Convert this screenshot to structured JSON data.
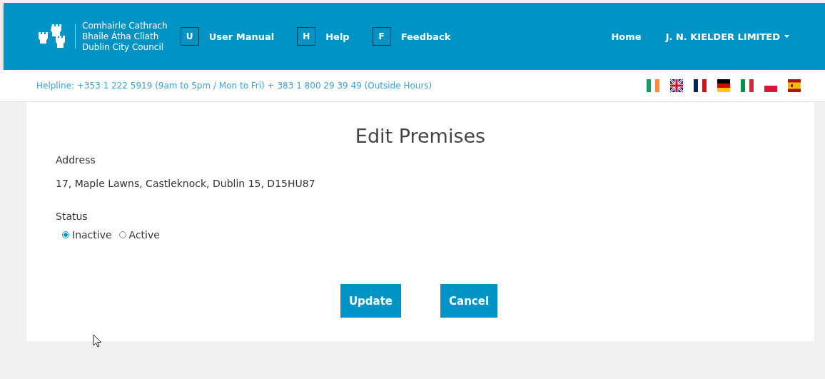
{
  "header": {
    "logo_lines": [
      "Comhairle Cathrach",
      "Bhaile Átha Cliath",
      "Dublin City Council"
    ],
    "links": [
      {
        "key": "U",
        "label": "User Manual"
      },
      {
        "key": "H",
        "label": "Help"
      },
      {
        "key": "F",
        "label": "Feedback"
      }
    ],
    "nav": {
      "home": "Home",
      "account": "J. N. KIELDER LIMITED"
    }
  },
  "helpline": "Helpline: +353 1 222 5919 (9am to 5pm / Mon to Fri) + 383 1 800 29 39 49 (Outside Hours)",
  "form": {
    "title": "Edit Premises",
    "address_label": "Address",
    "address": "17, Maple Lawns, Castleknock, Dublin 15, D15HU87",
    "status_label": "Status",
    "status_options": [
      {
        "label": "Inactive",
        "selected": true
      },
      {
        "label": "Active",
        "selected": false
      }
    ],
    "buttons": [
      "Update",
      "Cancel"
    ]
  }
}
